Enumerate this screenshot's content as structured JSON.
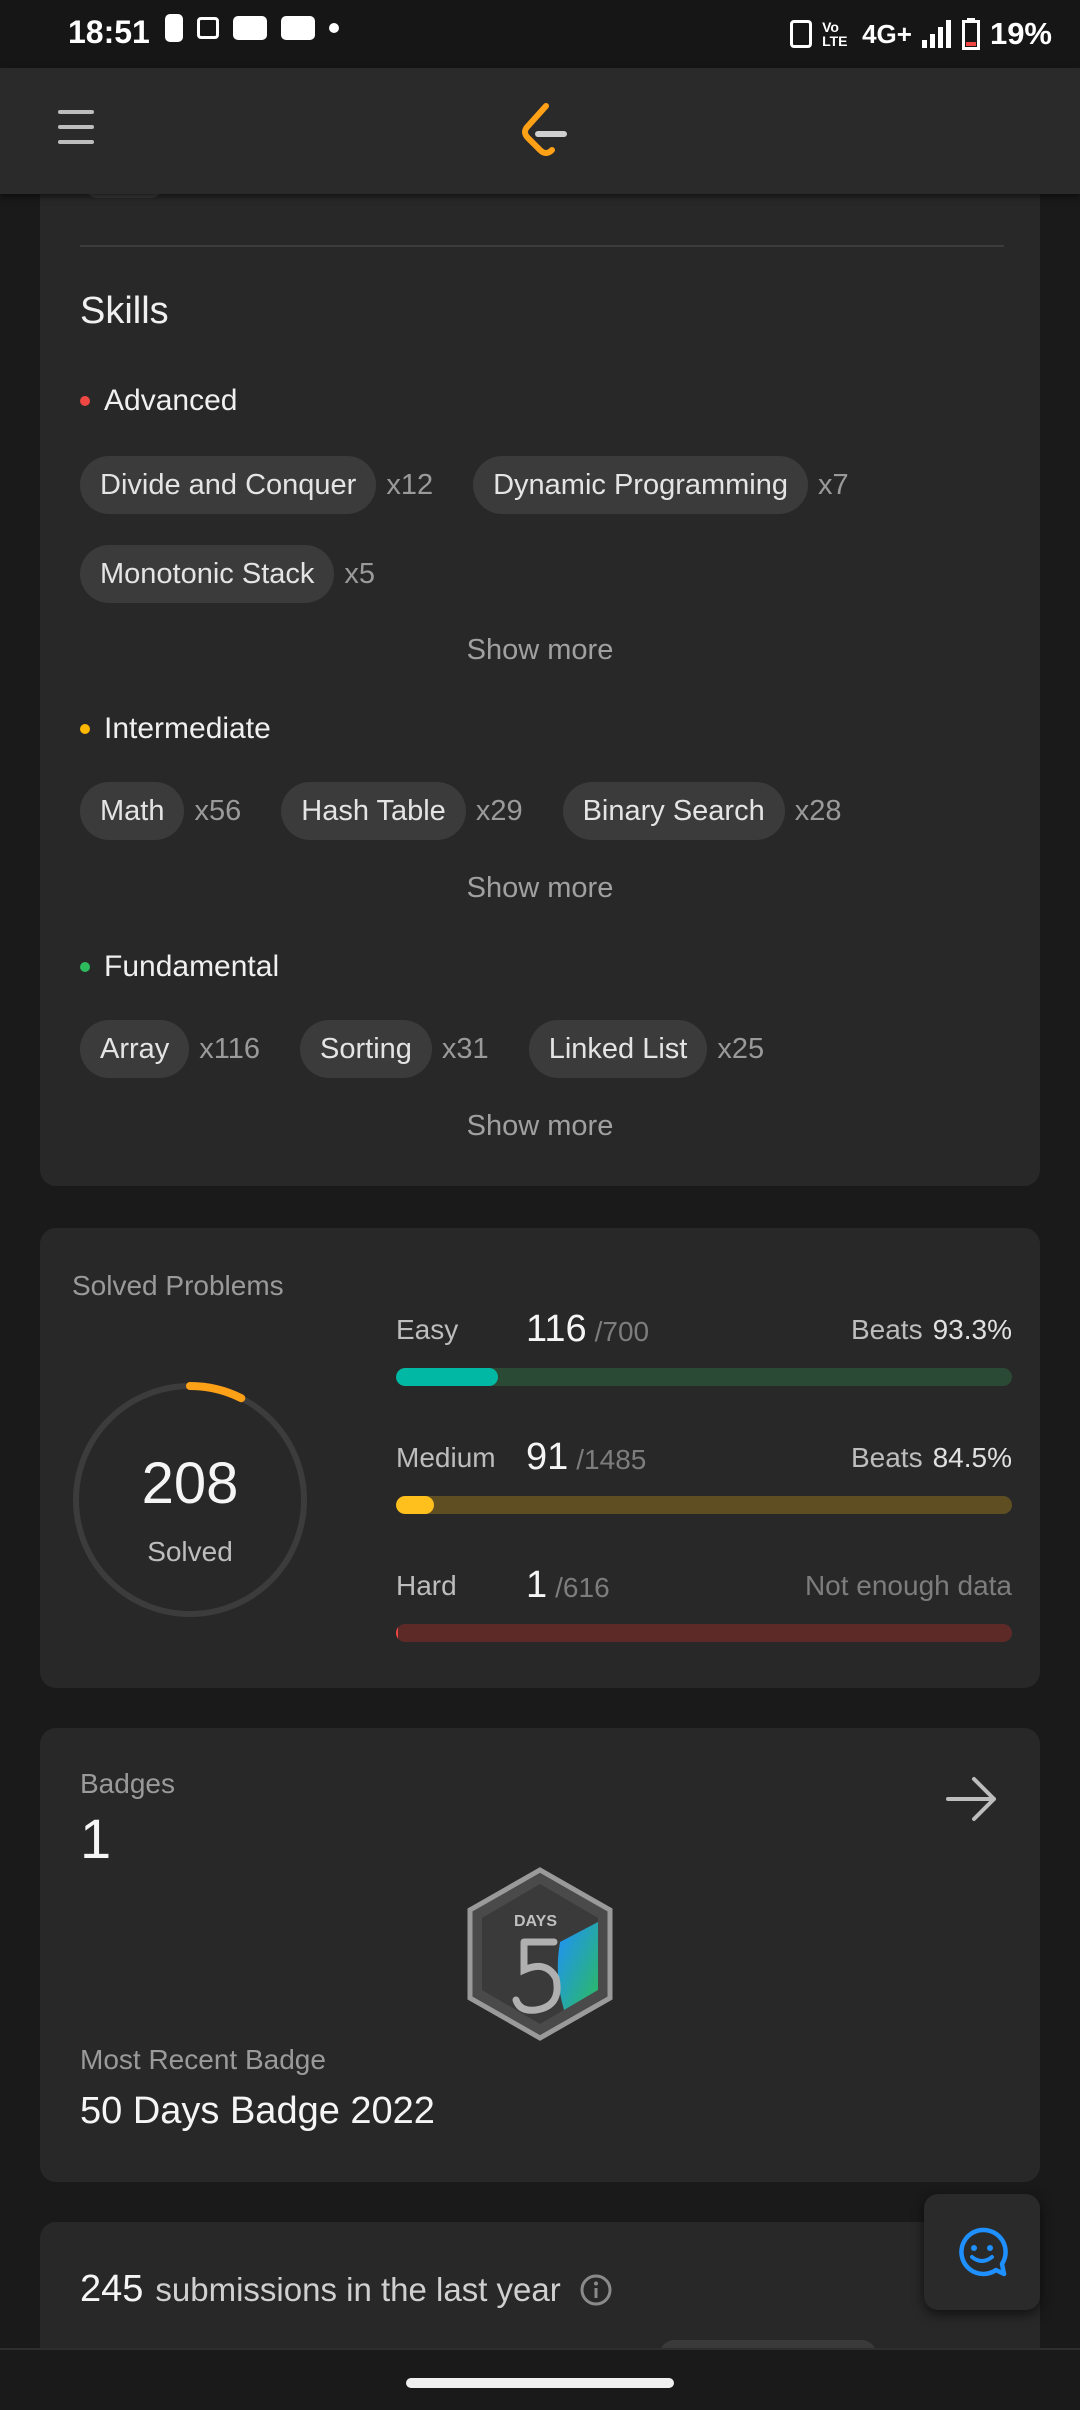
{
  "status_bar": {
    "time": "18:51",
    "network": "4G+",
    "volte": "Vo LTE",
    "battery": "19%"
  },
  "nav": {
    "menu_icon": "hamburger-menu-icon",
    "logo_icon": "leetcode-logo-icon"
  },
  "skills": {
    "title": "Skills",
    "groups": [
      {
        "label": "Advanced",
        "dot_color": "#ef4743",
        "items": [
          {
            "name": "Divide and Conquer",
            "count": "x12"
          },
          {
            "name": "Dynamic Programming",
            "count": "x7"
          },
          {
            "name": "Monotonic Stack",
            "count": "x5"
          }
        ],
        "show_more": "Show more"
      },
      {
        "label": "Intermediate",
        "dot_color": "#ffb800",
        "items": [
          {
            "name": "Math",
            "count": "x56"
          },
          {
            "name": "Hash Table",
            "count": "x29"
          },
          {
            "name": "Binary Search",
            "count": "x28"
          }
        ],
        "show_more": "Show more"
      },
      {
        "label": "Fundamental",
        "dot_color": "#2cbb5d",
        "items": [
          {
            "name": "Array",
            "count": "x116"
          },
          {
            "name": "Sorting",
            "count": "x31"
          },
          {
            "name": "Linked List",
            "count": "x25"
          }
        ],
        "show_more": "Show more"
      }
    ]
  },
  "solved": {
    "title": "Solved Problems",
    "total": "208",
    "total_label": "Solved",
    "ring_color": "#ffa116",
    "difficulties": [
      {
        "name": "Easy",
        "solved": "116",
        "total": "/700",
        "beats_label": "Beats",
        "beats": "93.3%",
        "progress": 0.166,
        "color": "#00b8a3",
        "track": "#2a4a35"
      },
      {
        "name": "Medium",
        "solved": "91",
        "total": "/1485",
        "beats_label": "Beats",
        "beats": "84.5%",
        "progress": 0.061,
        "color": "#ffc01e",
        "track": "#5e4e22"
      },
      {
        "name": "Hard",
        "solved": "1",
        "total": "/616",
        "note": "Not enough data",
        "progress": 0.002,
        "color": "#ef4743",
        "track": "#5e2a28"
      }
    ]
  },
  "badges": {
    "title": "Badges",
    "count": "1",
    "badge_icon": "50-days-badge-icon",
    "badge_text": "DAYS",
    "recent_label": "Most Recent Badge",
    "recent_name": "50 Days Badge 2022"
  },
  "submissions": {
    "count": "245",
    "text": "submissions in the last year"
  },
  "fab": {
    "icon": "chat-feedback-icon"
  }
}
